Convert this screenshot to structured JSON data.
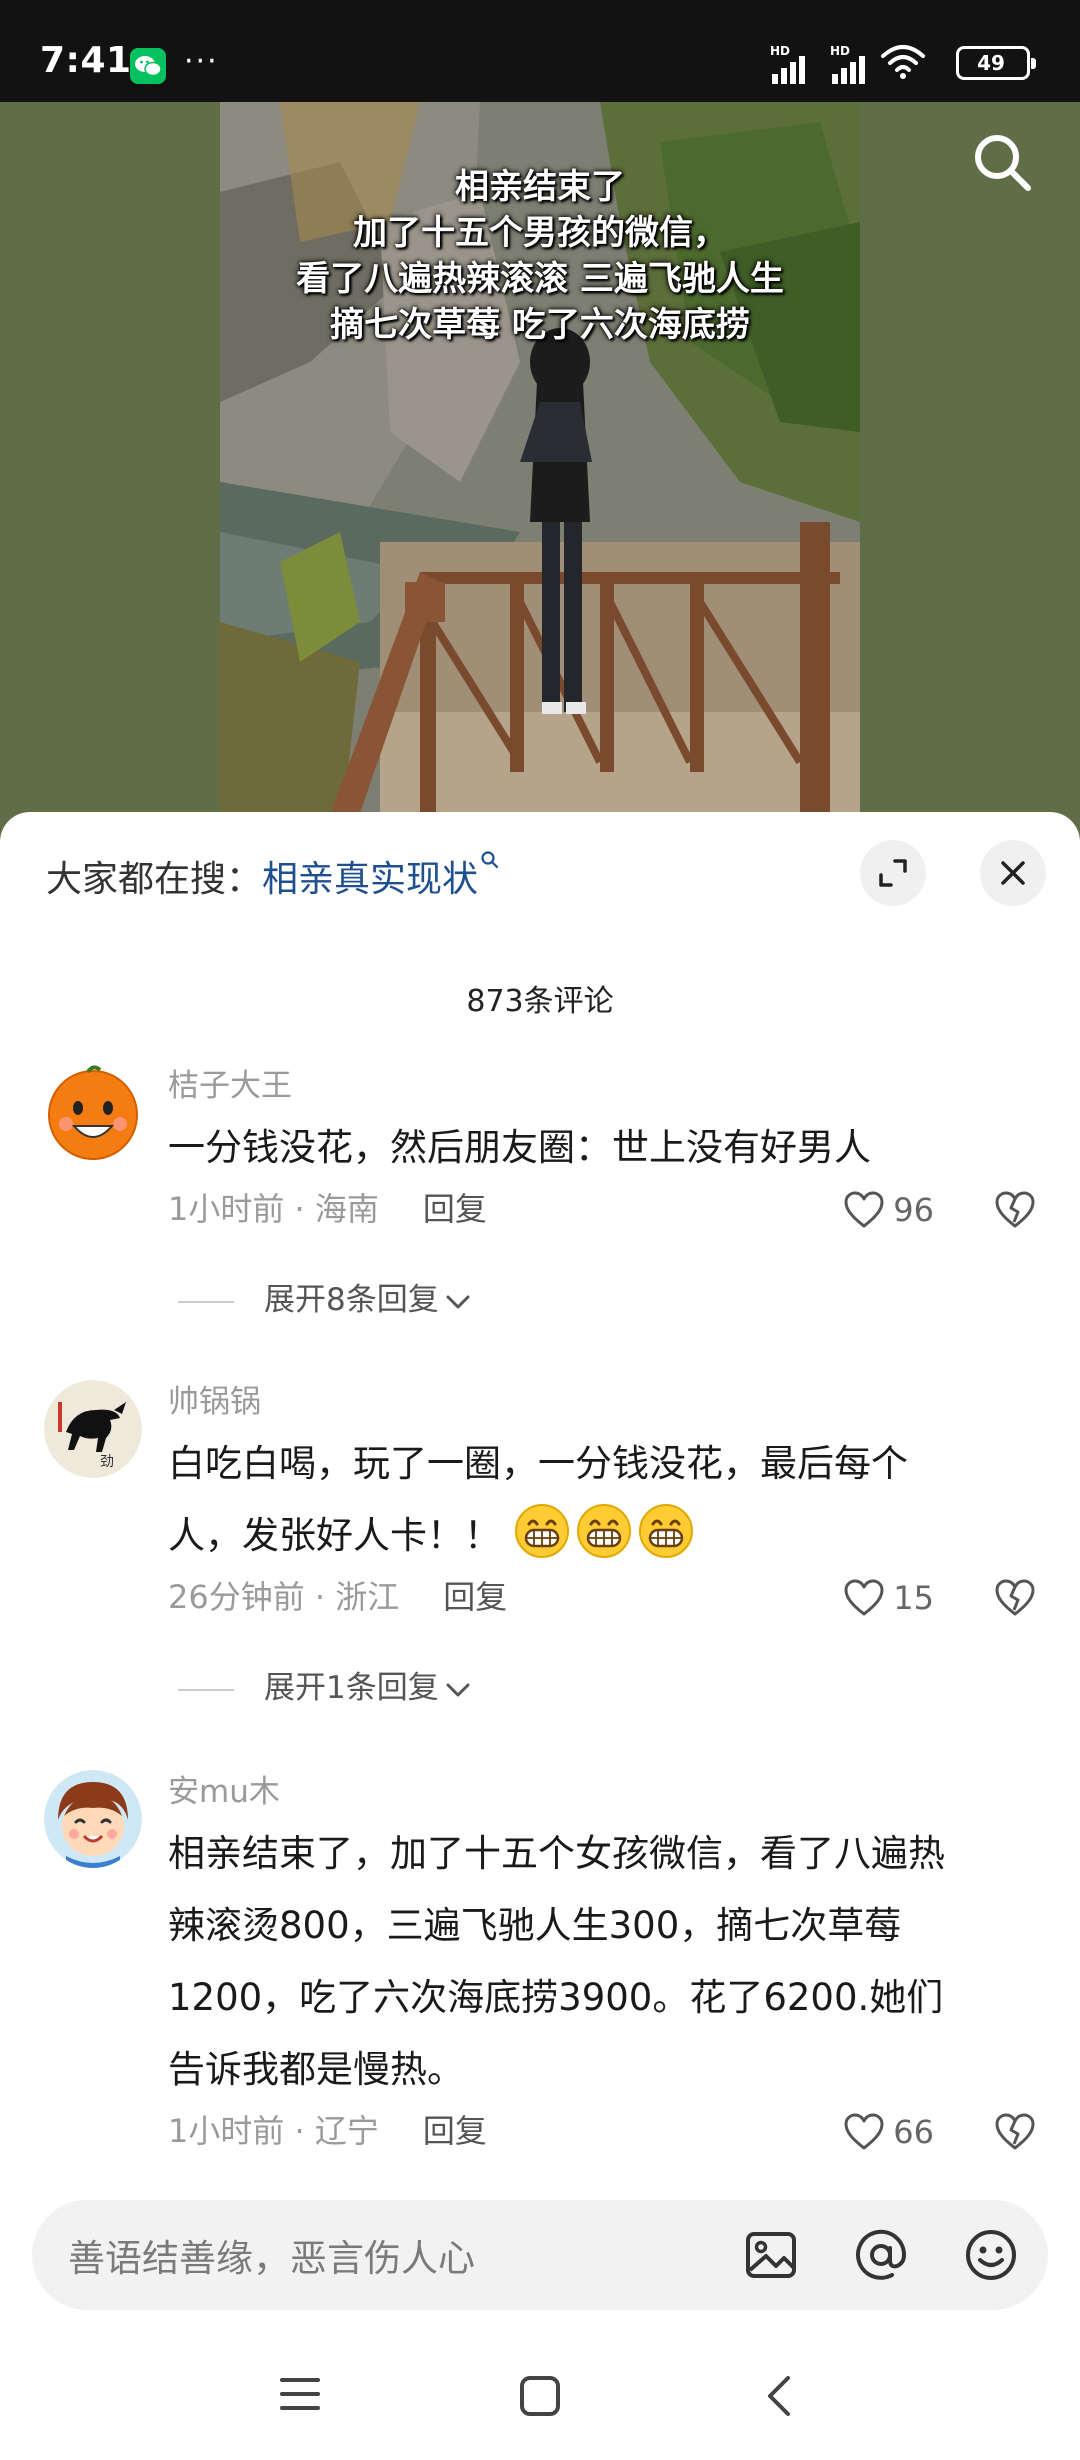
{
  "status_bar": {
    "time": "7:41",
    "more": "···",
    "battery": "49",
    "signal_label_1": "HD",
    "signal_label_2": "HD"
  },
  "video": {
    "overlay_lines": [
      "相亲结束了",
      "加了十五个男孩的微信，",
      "看了八遍热辣滚滚 三遍飞驰人生",
      "摘七次草莓 吃了六次海底捞"
    ]
  },
  "hot_search": {
    "prefix": "大家都在搜：",
    "query": "相亲真实现状"
  },
  "comment_count": "873条评论",
  "comments": [
    {
      "user": "桔子大王",
      "text": "一分钱没花，然后朋友圈：世上没有好男人",
      "time": "1小时前",
      "location": "海南",
      "reply_label": "回复",
      "likes": "96",
      "expand": "展开8条回复"
    },
    {
      "user": "帅锅锅",
      "text_line1": "白吃白喝，玩了一圈，一分钱没花，最后每个",
      "text_line2": "人，发张好人卡！！",
      "time": "26分钟前",
      "location": "浙江",
      "reply_label": "回复",
      "likes": "15",
      "expand": "展开1条回复"
    },
    {
      "user": "安mu木",
      "text_lines": [
        "相亲结束了，加了十五个女孩微信，看了八遍热",
        "辣滚烫800，三遍飞驰人生300，摘七次草莓",
        "1200，吃了六次海底捞3900。花了6200.她们",
        "告诉我都是慢热。"
      ],
      "time": "1小时前",
      "location": "辽宁",
      "reply_label": "回复",
      "likes": "66"
    }
  ],
  "input": {
    "placeholder": "善语结善缘，恶言伤人心"
  },
  "icons": {
    "status": [
      "wechat-icon",
      "signal-icon",
      "wifi-icon",
      "battery-icon"
    ],
    "sheet": [
      "expand-icon",
      "close-icon",
      "heart-icon",
      "dislike-icon",
      "chevron-down-icon"
    ],
    "input": [
      "image-icon",
      "at-icon",
      "emoji-icon"
    ],
    "nav": [
      "menu-icon",
      "home-icon",
      "back-icon"
    ]
  },
  "colors": {
    "link": "#1f4f8f",
    "meta_gray": "#9a9a9a",
    "status_bg": "#121212",
    "video_bg": "#5f6e47",
    "wechat_green": "#07c160"
  }
}
